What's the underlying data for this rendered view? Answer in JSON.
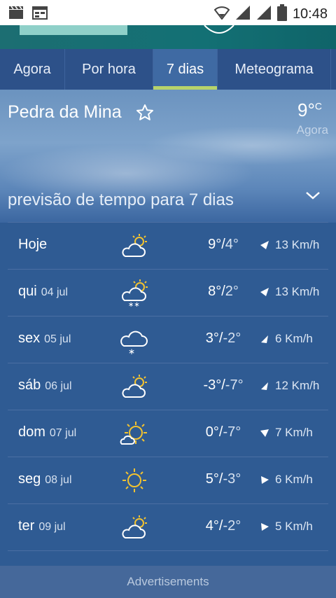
{
  "status_bar": {
    "time": "10:48",
    "icons": [
      "clapperboard-icon",
      "calendar-icon",
      "wifi-icon",
      "signal-icon",
      "signal-icon",
      "battery-icon"
    ]
  },
  "tabs": [
    {
      "label": "Agora",
      "active": false
    },
    {
      "label": "Por hora",
      "active": false
    },
    {
      "label": "7 dias",
      "active": true
    },
    {
      "label": "Meteograma",
      "active": false
    }
  ],
  "location": {
    "name": "Pedra da Mina",
    "current_temp": "9°",
    "current_unit": "C",
    "current_label": "Agora"
  },
  "forecast_title": "previsão de tempo para 7 dias",
  "days": [
    {
      "day": "Hoje",
      "date": "",
      "icon": "partly-cloudy-icon",
      "high": "9°",
      "low": "4°",
      "wind": "13 Km/h"
    },
    {
      "day": "qui",
      "date": "04 jul",
      "icon": "snow-partly-cloudy-icon",
      "high": "8°",
      "low": "2°",
      "wind": "13 Km/h"
    },
    {
      "day": "sex",
      "date": "05 jul",
      "icon": "snow-cloud-icon",
      "high": "3°",
      "low": "-2°",
      "wind": "6 Km/h"
    },
    {
      "day": "sáb",
      "date": "06 jul",
      "icon": "partly-cloudy-icon",
      "high": "-3°",
      "low": "-7°",
      "wind": "12 Km/h"
    },
    {
      "day": "dom",
      "date": "07 jul",
      "icon": "mostly-sunny-icon",
      "high": "0°",
      "low": "-7°",
      "wind": "7 Km/h"
    },
    {
      "day": "seg",
      "date": "08 jul",
      "icon": "sun-icon",
      "high": "5°",
      "low": "-3°",
      "wind": "6 Km/h"
    },
    {
      "day": "ter",
      "date": "09 jul",
      "icon": "partly-cloudy-icon",
      "high": "4°",
      "low": "-2°",
      "wind": "5 Km/h"
    }
  ],
  "ads_label": "Advertisements",
  "colors": {
    "tab_indicator": "#b7d36b",
    "sun": "#f3c330"
  }
}
